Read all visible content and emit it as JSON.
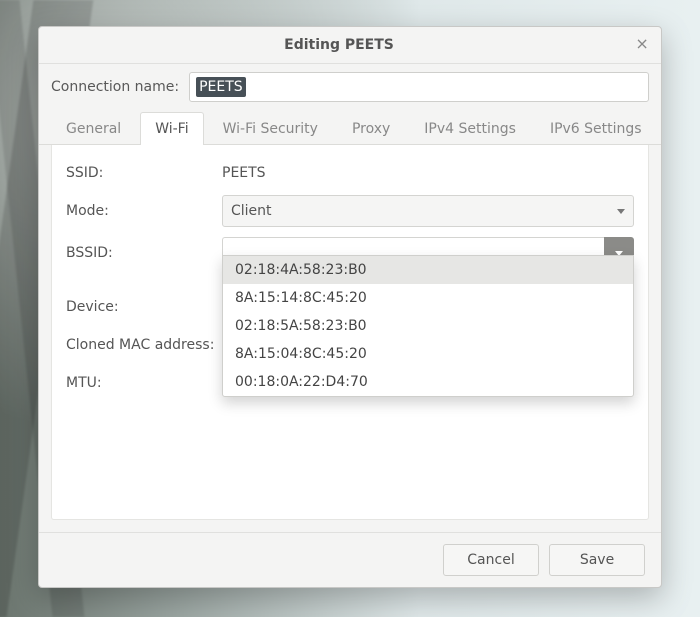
{
  "dialog": {
    "title": "Editing PEETS",
    "close_glyph": "×"
  },
  "header": {
    "connection_name_label": "Connection name:",
    "connection_name_value": "PEETS"
  },
  "tabs": [
    {
      "label": "General",
      "active": false
    },
    {
      "label": "Wi-Fi",
      "active": true
    },
    {
      "label": "Wi-Fi Security",
      "active": false
    },
    {
      "label": "Proxy",
      "active": false
    },
    {
      "label": "IPv4 Settings",
      "active": false
    },
    {
      "label": "IPv6 Settings",
      "active": false
    }
  ],
  "wifi": {
    "ssid_label": "SSID:",
    "ssid_value": "PEETS",
    "mode_label": "Mode:",
    "mode_value": "Client",
    "bssid_label": "BSSID:",
    "bssid_value": "",
    "bssid_options": [
      "02:18:4A:58:23:B0",
      "8A:15:14:8C:45:20",
      "02:18:5A:58:23:B0",
      "8A:15:04:8C:45:20",
      "00:18:0A:22:D4:70"
    ],
    "bssid_selected_index": 0,
    "device_label": "Device:",
    "cloned_mac_label": "Cloned MAC address:",
    "mtu_label": "MTU:"
  },
  "footer": {
    "cancel": "Cancel",
    "save": "Save"
  }
}
